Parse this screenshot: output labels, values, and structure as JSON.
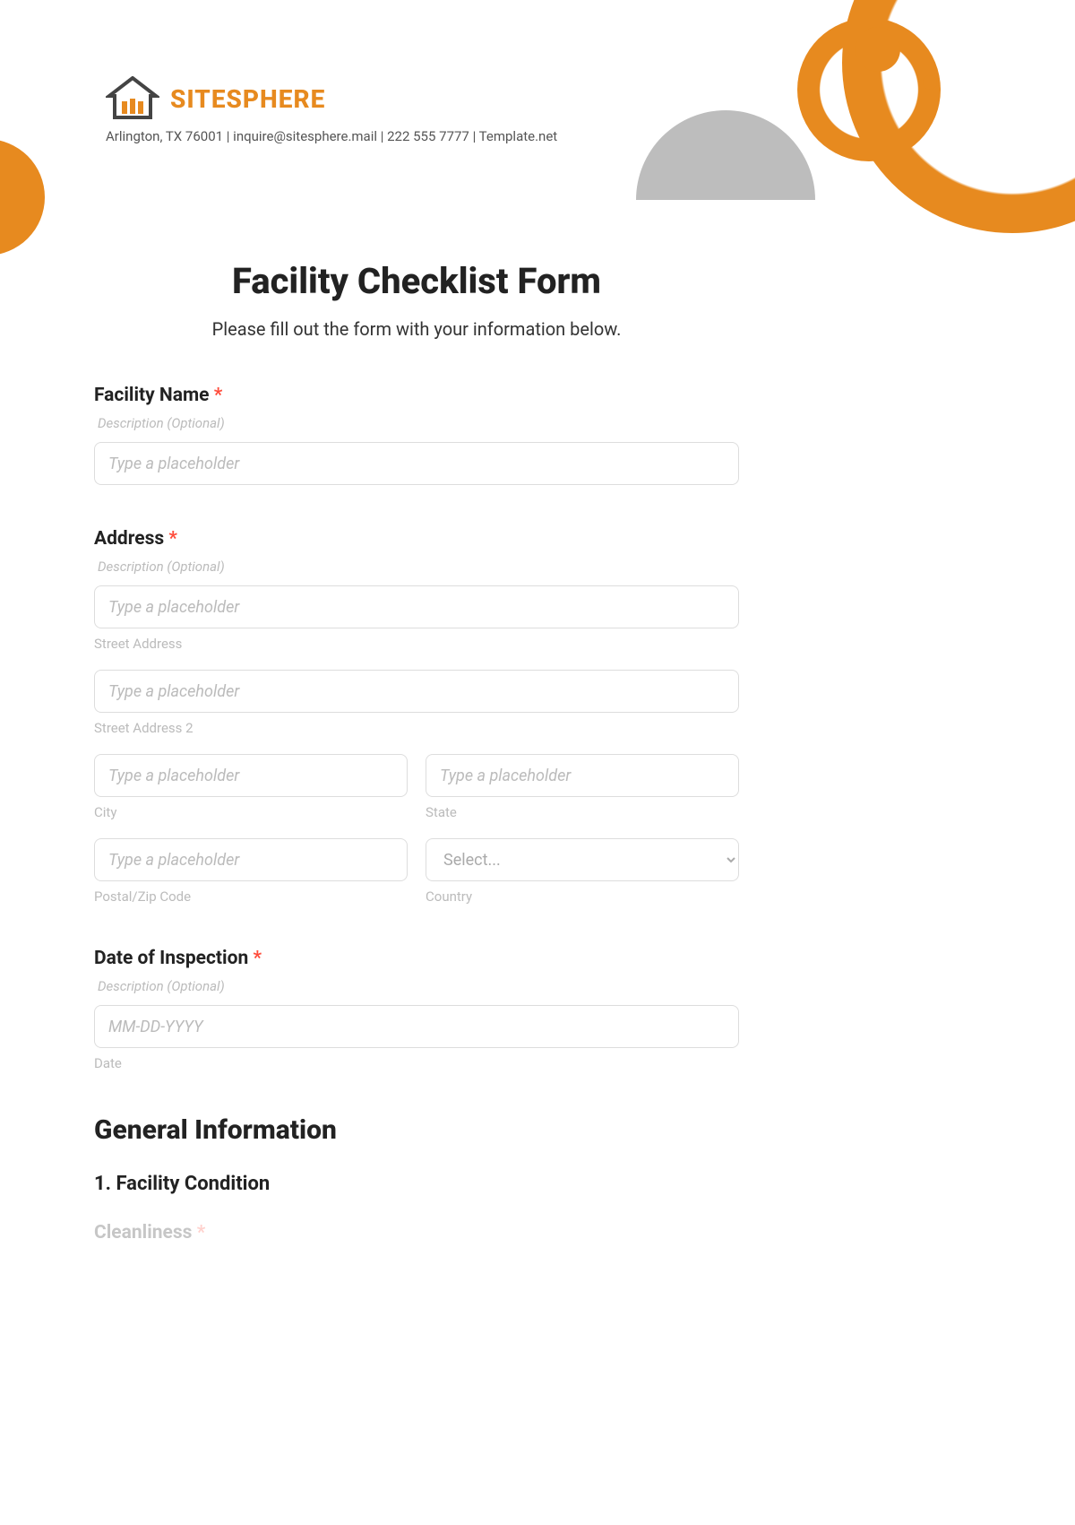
{
  "header": {
    "brand_name": "SITESPHERE",
    "contact_line": "Arlington, TX 76001 | inquire@sitesphere.mail | 222 555 7777 | Template.net"
  },
  "form": {
    "title": "Facility Checklist Form",
    "subtitle": "Please fill out the form with your information below.",
    "facility_name": {
      "label": "Facility Name",
      "required_mark": "*",
      "description": "Description (Optional)",
      "placeholder": "Type a placeholder"
    },
    "address": {
      "label": "Address",
      "required_mark": "*",
      "description": "Description (Optional)",
      "street1": {
        "placeholder": "Type a placeholder",
        "sublabel": "Street Address"
      },
      "street2": {
        "placeholder": "Type a placeholder",
        "sublabel": "Street Address 2"
      },
      "city": {
        "placeholder": "Type a placeholder",
        "sublabel": "City"
      },
      "state": {
        "placeholder": "Type a placeholder",
        "sublabel": "State"
      },
      "postal": {
        "placeholder": "Type a placeholder",
        "sublabel": "Postal/Zip Code"
      },
      "country": {
        "placeholder": "Select...",
        "sublabel": "Country"
      }
    },
    "date_inspection": {
      "label": "Date of Inspection",
      "required_mark": "*",
      "description": "Description (Optional)",
      "placeholder": "MM-DD-YYYY",
      "sublabel": "Date"
    },
    "section1": {
      "heading": "General Information",
      "sub1": "1. Facility Condition",
      "cleanliness_label": "Cleanliness",
      "cleanliness_req": "*"
    }
  }
}
